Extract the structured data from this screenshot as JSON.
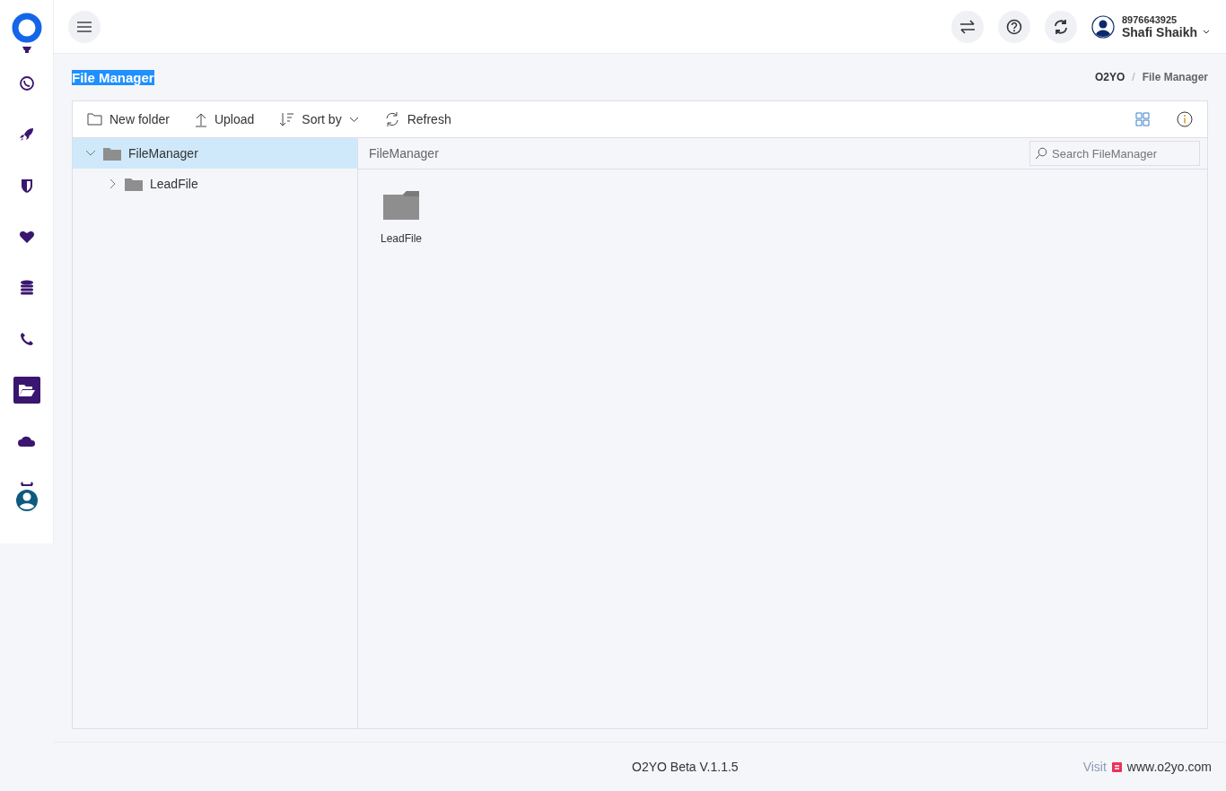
{
  "sidebar": {
    "items": [
      {
        "kind": "chat",
        "selected": false
      },
      {
        "kind": "rocket",
        "selected": false
      },
      {
        "kind": "shield",
        "selected": false
      },
      {
        "kind": "heart",
        "selected": false
      },
      {
        "kind": "database",
        "selected": false
      },
      {
        "kind": "phone",
        "selected": false
      },
      {
        "kind": "folder",
        "selected": true
      },
      {
        "kind": "cloud",
        "selected": false
      },
      {
        "kind": "profile",
        "selected": false
      }
    ]
  },
  "header": {
    "phone": "8976643925",
    "user": "Shafi Shaikh"
  },
  "page": {
    "title": "File Manager",
    "title_highlighted": true,
    "breadcrumb": [
      "O2YO",
      "File Manager"
    ],
    "breadcrumb_separator": "/"
  },
  "toolbar": {
    "buttons": [
      {
        "kind": "new-folder",
        "label": "New folder"
      },
      {
        "kind": "upload",
        "label": "Upload"
      },
      {
        "kind": "sort",
        "label": "Sort by"
      },
      {
        "kind": "refresh",
        "label": "Refresh"
      }
    ]
  },
  "tree": [
    {
      "label": "FileManager",
      "expanded": true,
      "selected": true,
      "children": [
        {
          "label": "LeadFile",
          "expanded": false,
          "selected": false
        }
      ]
    }
  ],
  "content": {
    "path": "FileManager",
    "search": {
      "placeholder": "Search FileManager"
    },
    "items": [
      {
        "label": "LeadFile"
      }
    ]
  },
  "footer": {
    "version": "O2YO Beta V.1.1.5",
    "visit": "Visit",
    "site": "www.o2yo.com"
  }
}
